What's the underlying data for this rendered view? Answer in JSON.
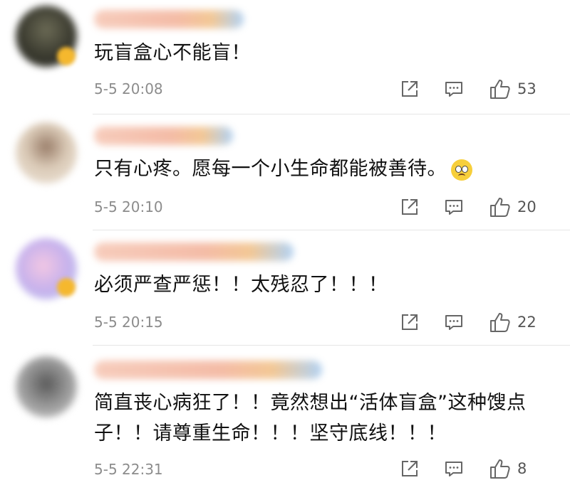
{
  "comments": [
    {
      "text": "玩盲盒心不能盲！",
      "time": "5-5 20:08",
      "likes": "53",
      "avatar_color": "#4a4538"
    },
    {
      "text": "只有心疼。愿每一个小生命都能被善待。",
      "time": "5-5 20:10",
      "likes": "20",
      "avatar_color": "#c9b7a3"
    },
    {
      "text": "必须严查严惩！！太残忍了！！！",
      "time": "5-5 20:15",
      "likes": "22",
      "avatar_color": "#c9b3e6"
    },
    {
      "text_line1": "简直丧心病狂了！！竟然想出“活体盲盒”这种馊点",
      "text_line2": "子！！请尊重生命！！！坚守底线！！！",
      "time": "5-5 22:31",
      "likes": "8",
      "avatar_color": "#8c8c8c"
    }
  ],
  "icons": {
    "share": "share-icon",
    "comment": "comment-icon",
    "like": "thumbs-up-icon",
    "emoji": "pleading-face-emoji-icon"
  }
}
